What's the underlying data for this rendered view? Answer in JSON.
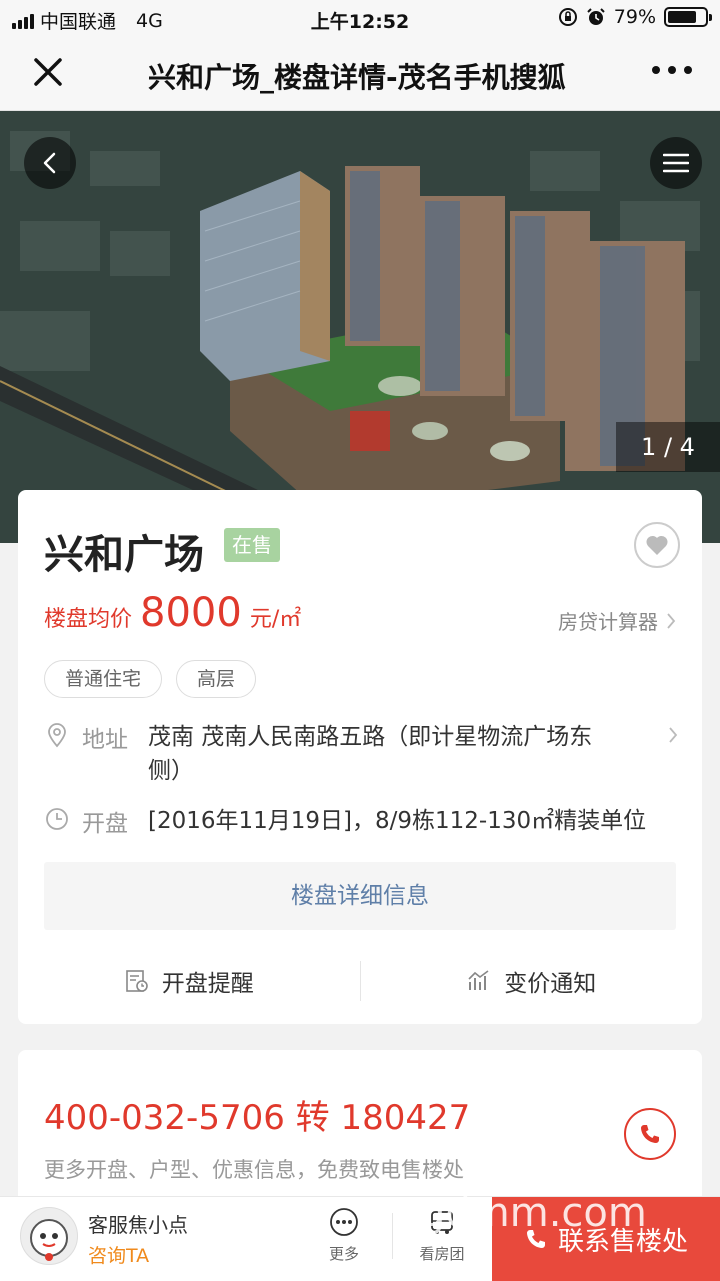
{
  "status_bar": {
    "carrier": "中国联通",
    "network": "4G",
    "time": "上午12:52",
    "battery": "79%",
    "battery_level": 0.79
  },
  "title_bar": {
    "title": "兴和广场_楼盘详情-茂名手机搜狐"
  },
  "hero": {
    "counter": "1 / 4"
  },
  "property": {
    "name": "兴和广场",
    "status_badge": "在售",
    "price_label": "楼盘均价",
    "price_value": "8000",
    "price_unit": "元/㎡",
    "mortgage_calculator": "房贷计算器",
    "tags": [
      "普通住宅",
      "高层"
    ],
    "address_label": "地址",
    "address_value": "茂南 茂南人民南路五路（即计星物流广场东侧）",
    "opening_label": "开盘",
    "opening_value": "[2016年11月19日]，8/9栋112-130㎡精装单位",
    "detail_button": "楼盘详细信息",
    "opening_reminder": "开盘提醒",
    "price_change_notice": "变价通知"
  },
  "contact_card": {
    "phone": "400-032-5706 转 180427",
    "subtitle": "更多开盘、户型、优惠信息，免费致电售楼处"
  },
  "bottom_bar": {
    "agent_name": "客服焦小点",
    "consult": "咨询TA",
    "more": "更多",
    "group_tour": "看房团",
    "contact_sales": "联系售楼处",
    "accent_color": "#e8493c"
  },
  "watermark": "gdmm.com"
}
